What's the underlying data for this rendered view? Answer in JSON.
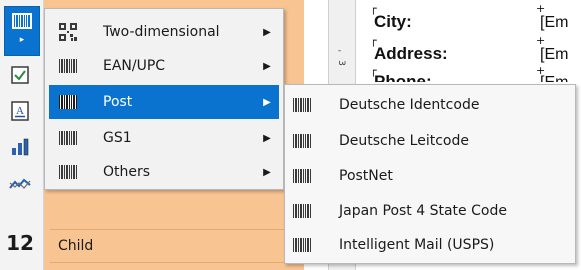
{
  "toolbar": {
    "tools": [
      {
        "icon": "barcode-icon"
      },
      {
        "icon": "checkbox-icon"
      },
      {
        "icon": "text-box-icon"
      },
      {
        "icon": "bar-chart-icon"
      },
      {
        "icon": "sparkline-icon"
      },
      {
        "icon": "number-icon",
        "glyph": "12"
      }
    ],
    "submenu_arrow": "▸"
  },
  "menu": {
    "items": [
      {
        "label": "Two-dimensional",
        "icon": "qr-code-icon",
        "has_submenu": true
      },
      {
        "label": "EAN/UPC",
        "icon": "barcode-icon",
        "has_submenu": true
      },
      {
        "label": "Post",
        "icon": "barcode-icon",
        "has_submenu": true,
        "highlighted": true
      },
      {
        "label": "GS1",
        "icon": "barcode-icon",
        "has_submenu": true
      },
      {
        "label": "Others",
        "icon": "barcode-icon",
        "has_submenu": true
      }
    ],
    "chevron": "▶"
  },
  "submenu": {
    "items": [
      {
        "label": "Deutsche Identcode",
        "icon": "barcode-icon"
      },
      {
        "label": "Deutsche Leitcode",
        "icon": "barcode-icon"
      },
      {
        "label": "PostNet",
        "icon": "barcode-icon"
      },
      {
        "label": "Japan Post 4 State Code",
        "icon": "barcode-icon"
      },
      {
        "label": "Intelligent Mail (USPS)",
        "icon": "barcode-icon"
      }
    ]
  },
  "designer": {
    "child_band_label": "Child"
  },
  "ruler": {
    "marks": [
      "-",
      "3"
    ]
  },
  "report": {
    "fields": [
      {
        "label": "City:",
        "value": "[Em"
      },
      {
        "label": "Address:",
        "value": "[Em"
      },
      {
        "label": "Phone:",
        "value": "[Em"
      }
    ]
  },
  "colors": {
    "accent": "#0a72cf",
    "band": "#f8c492",
    "menu_bg": "#f2f2f2"
  }
}
